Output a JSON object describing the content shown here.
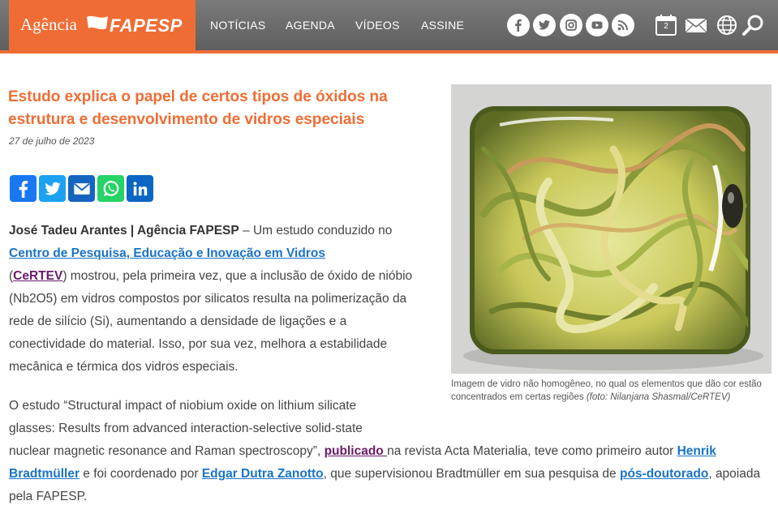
{
  "header": {
    "logo_agencia": "Agência",
    "logo_fapesp": "FAPESP",
    "nav": [
      "NOTÍCIAS",
      "AGENDA",
      "VÍDEOS",
      "ASSINE"
    ],
    "social_icons": [
      "facebook-icon",
      "twitter-icon",
      "instagram-icon",
      "youtube-icon",
      "rss-icon"
    ],
    "calendar_day": "2",
    "accent_color": "#ef6d35"
  },
  "article": {
    "title": "Estudo explica o papel de certos tipos de óxidos na estrutura e desenvolvimento de vidros especiais",
    "date": "27 de julho de 2023",
    "share": [
      "facebook",
      "twitter",
      "email",
      "whatsapp",
      "linkedin"
    ],
    "p1": {
      "author": "José Tadeu Arantes | Agência FAPESP",
      "t1": " – Um estudo conduzido no ",
      "link_center": "Centro de Pesquisa, Educação e Inovação em Vidros",
      "t2": " (",
      "link_certev": "CeRTEV",
      "t3": ") mostrou, pela primeira vez, que a inclusão de óxido de nióbio (Nb2O5) em vidros compostos por silicatos resulta na polimerização da rede de silício (Si), aumentando a densidade de ligações e a conectividade do material. Isso, por sua vez, melhora a estabilidade mecânica e térmica dos vidros especiais."
    },
    "p2": {
      "t1": "O estudo “Structural impact of niobium oxide on lithium silicate glasses: Results from advanced interaction-selective solid-state",
      "t2": "nuclear magnetic resonance and Raman spectroscopy”, ",
      "link_publicado": "publicado ",
      "t3": "na revista Acta Materialia, teve como primeiro autor ",
      "link_henrik": "Henrik Bradtmüller",
      "t4": " e foi coordenado por ",
      "link_edgar": "Edgar Dutra Zanotto",
      "t5": ", que supervisionou Bradtmüller em sua pesquisa de ",
      "link_pos": "pós-doutorado",
      "t6": ", apoiada pela FAPESP."
    },
    "caption": {
      "text": "Imagem de vidro não homogêneo, no qual os elementos que dão cor estão concentrados em certas regiões ",
      "credit": "(foto: Nilanjana Shasmal/CeRTEV)"
    }
  }
}
